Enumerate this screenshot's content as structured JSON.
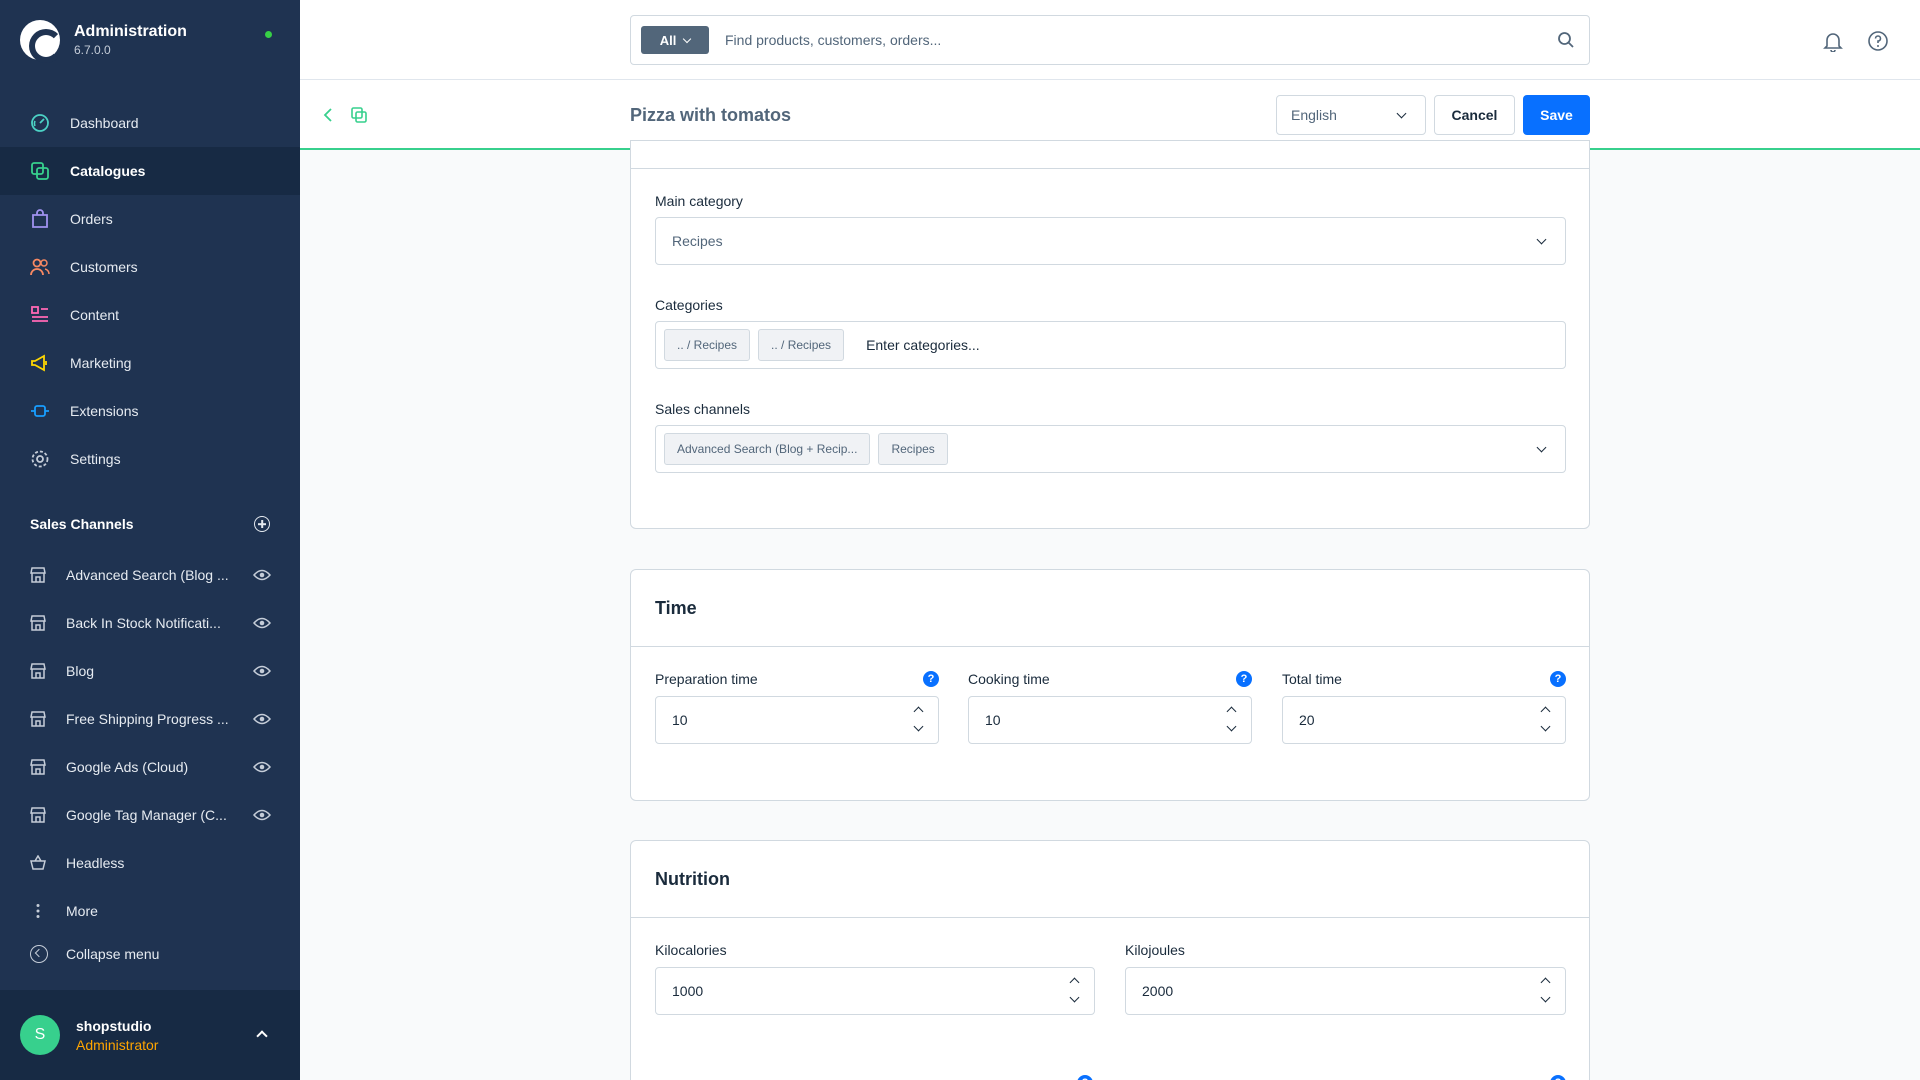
{
  "brand": {
    "title": "Administration",
    "version": "6.7.0.0"
  },
  "nav": [
    {
      "label": "Dashboard",
      "icon": "dashboard-icon"
    },
    {
      "label": "Catalogues",
      "icon": "catalogues-icon"
    },
    {
      "label": "Orders",
      "icon": "orders-icon"
    },
    {
      "label": "Customers",
      "icon": "customers-icon"
    },
    {
      "label": "Content",
      "icon": "content-icon"
    },
    {
      "label": "Marketing",
      "icon": "marketing-icon"
    },
    {
      "label": "Extensions",
      "icon": "extensions-icon"
    },
    {
      "label": "Settings",
      "icon": "settings-icon"
    }
  ],
  "sales_channels": {
    "title": "Sales Channels",
    "items": [
      {
        "label": "Advanced Search (Blog ..."
      },
      {
        "label": "Back In Stock Notificati..."
      },
      {
        "label": "Blog"
      },
      {
        "label": "Free Shipping Progress ..."
      },
      {
        "label": "Google Ads (Cloud)"
      },
      {
        "label": "Google Tag Manager (C..."
      },
      {
        "label": "Headless"
      }
    ],
    "more": "More",
    "collapse": "Collapse menu"
  },
  "user": {
    "initial": "S",
    "name": "shopstudio",
    "role": "Administrator"
  },
  "search": {
    "type": "All",
    "placeholder": "Find products, customers, orders..."
  },
  "smartbar": {
    "title": "Pizza with tomatos",
    "language": "English",
    "cancel": "Cancel",
    "save": "Save"
  },
  "assignment": {
    "main_category_label": "Main category",
    "main_category_value": "Recipes",
    "categories_label": "Categories",
    "categories_tags": [
      ".. / Recipes",
      ".. / Recipes"
    ],
    "categories_placeholder": "Enter categories...",
    "sales_channels_label": "Sales channels",
    "sales_channels_tags": [
      "Advanced Search (Blog + Recip...",
      "Recipes"
    ]
  },
  "time": {
    "title": "Time",
    "fields": [
      {
        "label": "Preparation time",
        "value": "10"
      },
      {
        "label": "Cooking time",
        "value": "10"
      },
      {
        "label": "Total time",
        "value": "20"
      }
    ]
  },
  "nutrition": {
    "title": "Nutrition",
    "fields": [
      {
        "label": "Kilocalories",
        "value": "1000"
      },
      {
        "label": "Kilojoules",
        "value": "2000"
      }
    ]
  },
  "colors": {
    "sidebar": "#1f3351",
    "accent": "#0870ff",
    "green": "#37d08d",
    "admin_role": "#ffa500"
  }
}
